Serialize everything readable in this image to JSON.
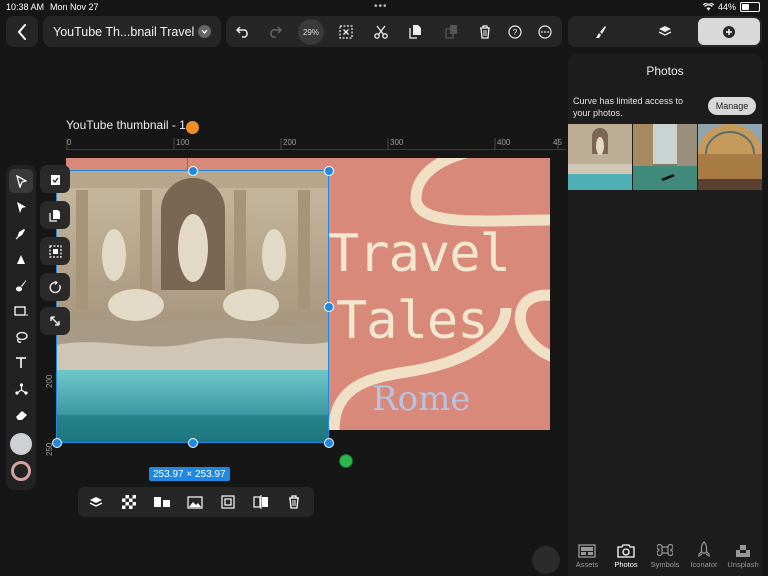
{
  "status_bar": {
    "time": "10:38 AM",
    "date": "Mon Nov 27",
    "battery": "44%"
  },
  "document": {
    "title": "YouTube Th...bnail Travel",
    "zoom": "29%"
  },
  "canvas": {
    "artboard_label": "YouTube thumbnail - 1",
    "ruler_h": [
      "0",
      "100",
      "200",
      "300",
      "400",
      "45"
    ],
    "ruler_v": [
      "100",
      "200",
      "250"
    ],
    "art_title_1": "Travel",
    "art_title_2": "Tales",
    "art_subtitle": "Rome",
    "selection_size": "253.97 × 253.97",
    "colors": {
      "artboard": "#d9897a",
      "title_text": "#f3e8cf",
      "subtitle_text": "#b7c4e0",
      "selection": "#1e88e5"
    }
  },
  "tools": [
    "select-tool",
    "direct-select-tool",
    "pen-tool",
    "vector-brush-tool",
    "paint-brush-tool",
    "rectangle-tool",
    "lasso-tool",
    "text-tool",
    "node-tool",
    "eraser-tool",
    "fill-color",
    "stroke-color"
  ],
  "panel": {
    "title": "Photos",
    "message": "Curve has limited access to your photos.",
    "manage_label": "Manage",
    "tabs": [
      {
        "label": "Assets",
        "icon": "assets-icon"
      },
      {
        "label": "Photos",
        "icon": "camera-icon"
      },
      {
        "label": "Symbols",
        "icon": "command-icon"
      },
      {
        "label": "Iconator",
        "icon": "rocket-icon"
      },
      {
        "label": "Unsplash",
        "icon": "unsplash-icon"
      }
    ]
  }
}
